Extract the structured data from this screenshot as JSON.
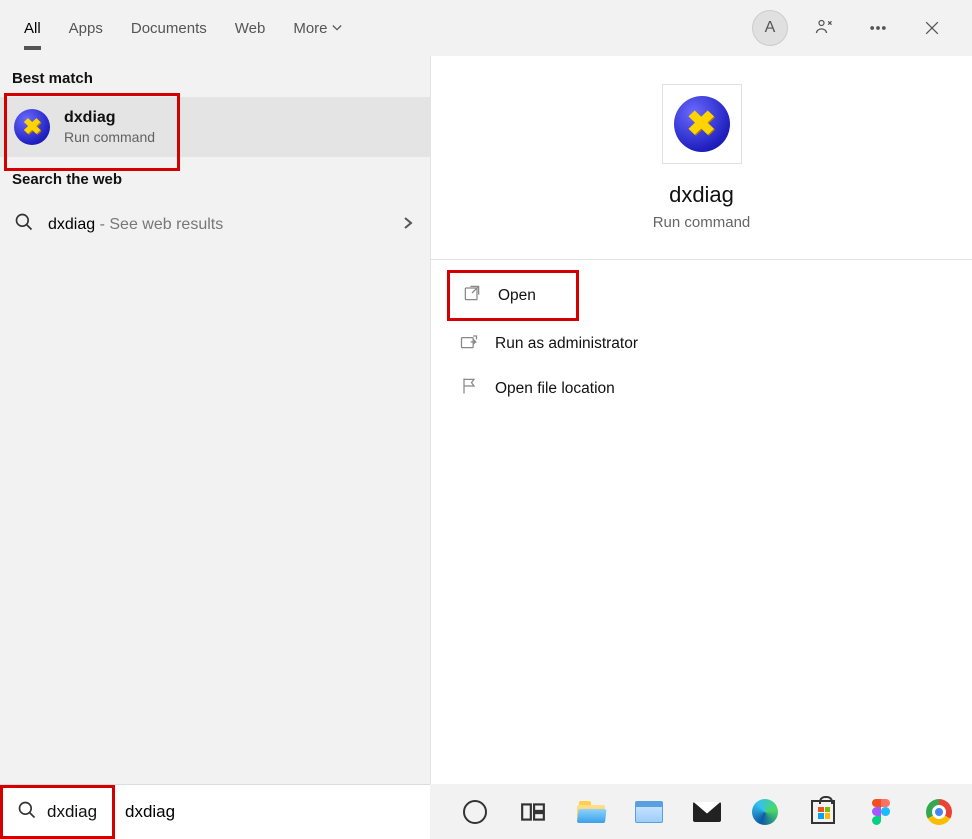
{
  "tabs": {
    "all": "All",
    "apps": "Apps",
    "documents": "Documents",
    "web": "Web",
    "more": "More"
  },
  "user_initial": "A",
  "left": {
    "best_match_label": "Best match",
    "result": {
      "title": "dxdiag",
      "subtitle": "Run command"
    },
    "search_web_label": "Search the web",
    "web_result": {
      "term": "dxdiag",
      "suffix": " - See web results"
    }
  },
  "detail": {
    "title": "dxdiag",
    "subtitle": "Run command",
    "actions": {
      "open": "Open",
      "run_admin": "Run as administrator",
      "open_location": "Open file location"
    }
  },
  "search": {
    "query": "dxdiag"
  }
}
